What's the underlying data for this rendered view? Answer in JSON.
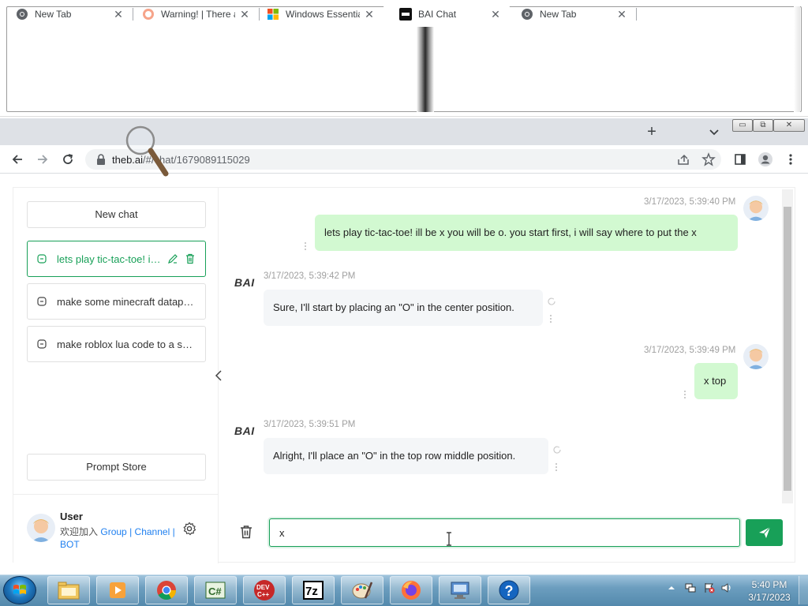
{
  "browser": {
    "tabs": [
      {
        "title": "New Tab",
        "icon": "chrome-icon"
      },
      {
        "title": "Warning! | There a",
        "icon": "warning-site-icon"
      },
      {
        "title": "Windows Essentia",
        "icon": "windows-icon"
      },
      {
        "title": "BAI Chat",
        "icon": "bai-icon",
        "active": true
      },
      {
        "title": "New Tab",
        "icon": "chrome-icon"
      }
    ],
    "url_host": "theb.ai",
    "url_path": "/#/chat/1679089115029"
  },
  "sidebar": {
    "new_chat": "New chat",
    "conversations": [
      {
        "title": "lets play tic-tac-toe! ill be x you will be o. you start first, i will say where to put the x",
        "active": true
      },
      {
        "title": "make some minecraft datapack code"
      },
      {
        "title": "make roblox lua code to a script"
      }
    ],
    "prompt_store": "Prompt Store",
    "user": {
      "name": "User",
      "join_prefix": "欢迎加入",
      "group": "Group",
      "sep1": "|",
      "channel": "Channel",
      "sep2": "|",
      "bot": "BOT"
    }
  },
  "chat": {
    "bot_label": "BAI",
    "messages": [
      {
        "role": "user",
        "time": "3/17/2023, 5:39:40 PM",
        "text": "lets play tic-tac-toe! ill be x you will be o. you start first, i will say where to put the x"
      },
      {
        "role": "bot",
        "time": "3/17/2023, 5:39:42 PM",
        "text": "Sure, I'll start by placing an \"O\" in the center position."
      },
      {
        "role": "user",
        "time": "3/17/2023, 5:39:49 PM",
        "text": "x top"
      },
      {
        "role": "bot",
        "time": "3/17/2023, 5:39:51 PM",
        "text": "Alright, I'll place an \"O\" in the top row middle position."
      }
    ],
    "input_value": "x"
  },
  "taskbar": {
    "items": [
      "file-explorer-icon",
      "media-player-icon",
      "chrome-icon",
      "csharp-icon",
      "devcpp-icon",
      "7zip-icon",
      "paint-icon",
      "firefox-icon",
      "remote-desktop-icon",
      "help-icon"
    ],
    "time": "5:40 PM",
    "date": "3/17/2023"
  },
  "colors": {
    "accent": "#18a058",
    "user_bubble": "#d2f9d1",
    "bot_bubble": "#f4f6f8",
    "link": "#2080f0"
  }
}
